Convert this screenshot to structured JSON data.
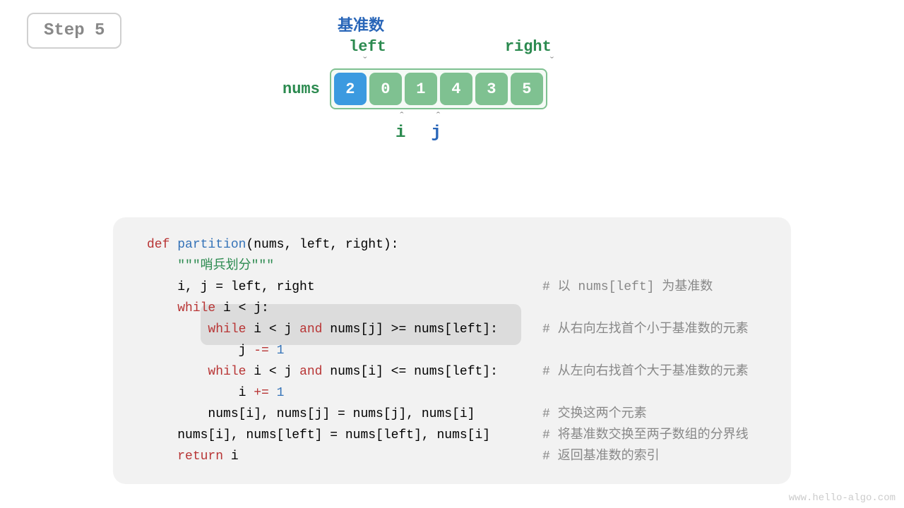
{
  "step": {
    "label": "Step 5"
  },
  "diagram": {
    "pivot_label": "基准数",
    "left_label": "left",
    "right_label": "right",
    "nums_label": "nums",
    "i_label": "i",
    "j_label": "j",
    "cells": [
      "2",
      "0",
      "1",
      "4",
      "3",
      "5"
    ],
    "pivot_index": 0,
    "i_index": 1,
    "j_index": 2
  },
  "code": {
    "def": "def",
    "fn_name": "partition",
    "params": "(nums, left, right):",
    "docstring": "\"\"\"哨兵划分\"\"\"",
    "l_init": "i, j = left, right",
    "c_init": "# 以 nums[left] 为基准数",
    "while1_kw": "while",
    "while1_cond": " i < j:",
    "while2_kw": "while",
    "while2_cond": " i < j ",
    "and_kw": "and",
    "while2_rest": " nums[j] >= nums[left]:",
    "c_while2": "# 从右向左找首个小于基准数的元素",
    "dec_var": "j ",
    "dec_op": "-=",
    "dec_num": " 1",
    "while3_kw": "while",
    "while3_cond": " i < j ",
    "while3_rest": " nums[i] <= nums[left]:",
    "c_while3": "# 从左向右找首个大于基准数的元素",
    "inc_var": "i ",
    "inc_op": "+=",
    "inc_num": " 1",
    "swap1": "nums[i], nums[j] = nums[j], nums[i]",
    "c_swap1": "# 交换这两个元素",
    "swap2": "nums[i], nums[left] = nums[left], nums[i]",
    "c_swap2": "# 将基准数交换至两子数组的分界线",
    "ret_kw": "return",
    "ret_val": " i",
    "c_ret": "# 返回基准数的索引"
  },
  "watermark": "www.hello-algo.com"
}
